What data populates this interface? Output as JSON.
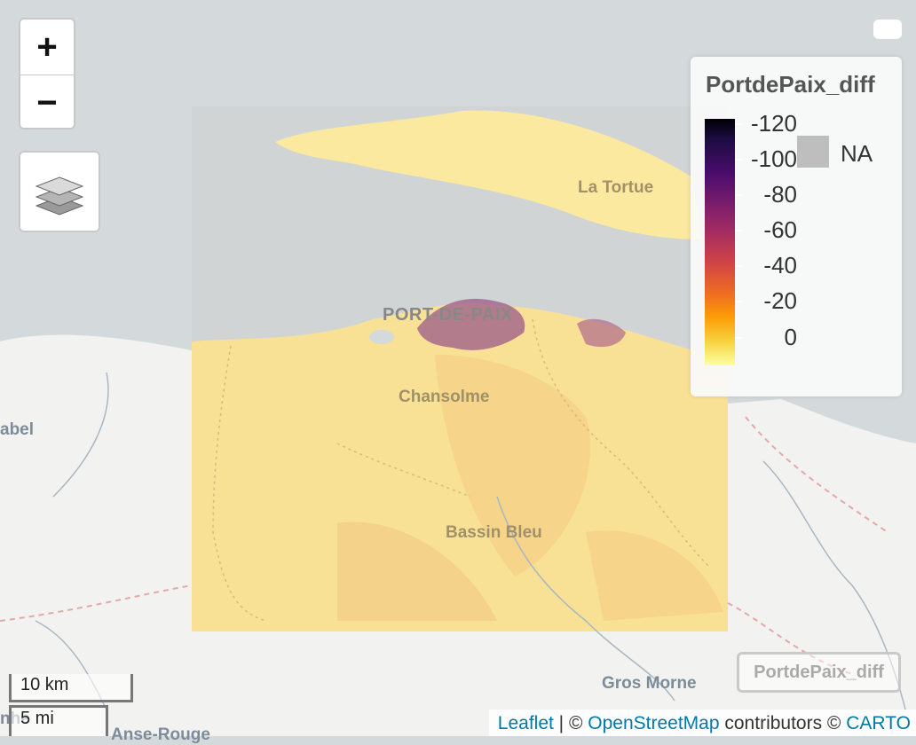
{
  "map": {
    "labels": {
      "la_tortue": "La Tortue",
      "port_de_paix": "PORT-DE-PAIX",
      "chansolme": "Chansolme",
      "bassin_bleu": "Bassin Bleu",
      "gros_morne": "Gros Morne",
      "abel": "abel",
      "anse_rouge": "Anse-Rouge",
      "nhe": "nhe"
    }
  },
  "controls": {
    "zoom_in": "+",
    "zoom_out": "−",
    "layers_icon": "layers-icon"
  },
  "legend": {
    "title": "PortdePaix_diff",
    "ticks": [
      "-120",
      "-100",
      "-80",
      "-60",
      "-40",
      "-20",
      "0"
    ],
    "na_label": "NA",
    "palette": [
      "#000004",
      "#4a0c6b",
      "#a52c60",
      "#ed6925",
      "#fb9b06",
      "#fcffa4"
    ],
    "na_color": "#bebebe"
  },
  "layer_button": {
    "label": "PortdePaix_diff"
  },
  "scale": {
    "km": "10 km",
    "mi": "5 mi"
  },
  "attribution": {
    "leaflet": "Leaflet",
    "sep1": " | © ",
    "osm": "OpenStreetMap",
    "mid": " contributors © ",
    "carto": "CARTO"
  }
}
